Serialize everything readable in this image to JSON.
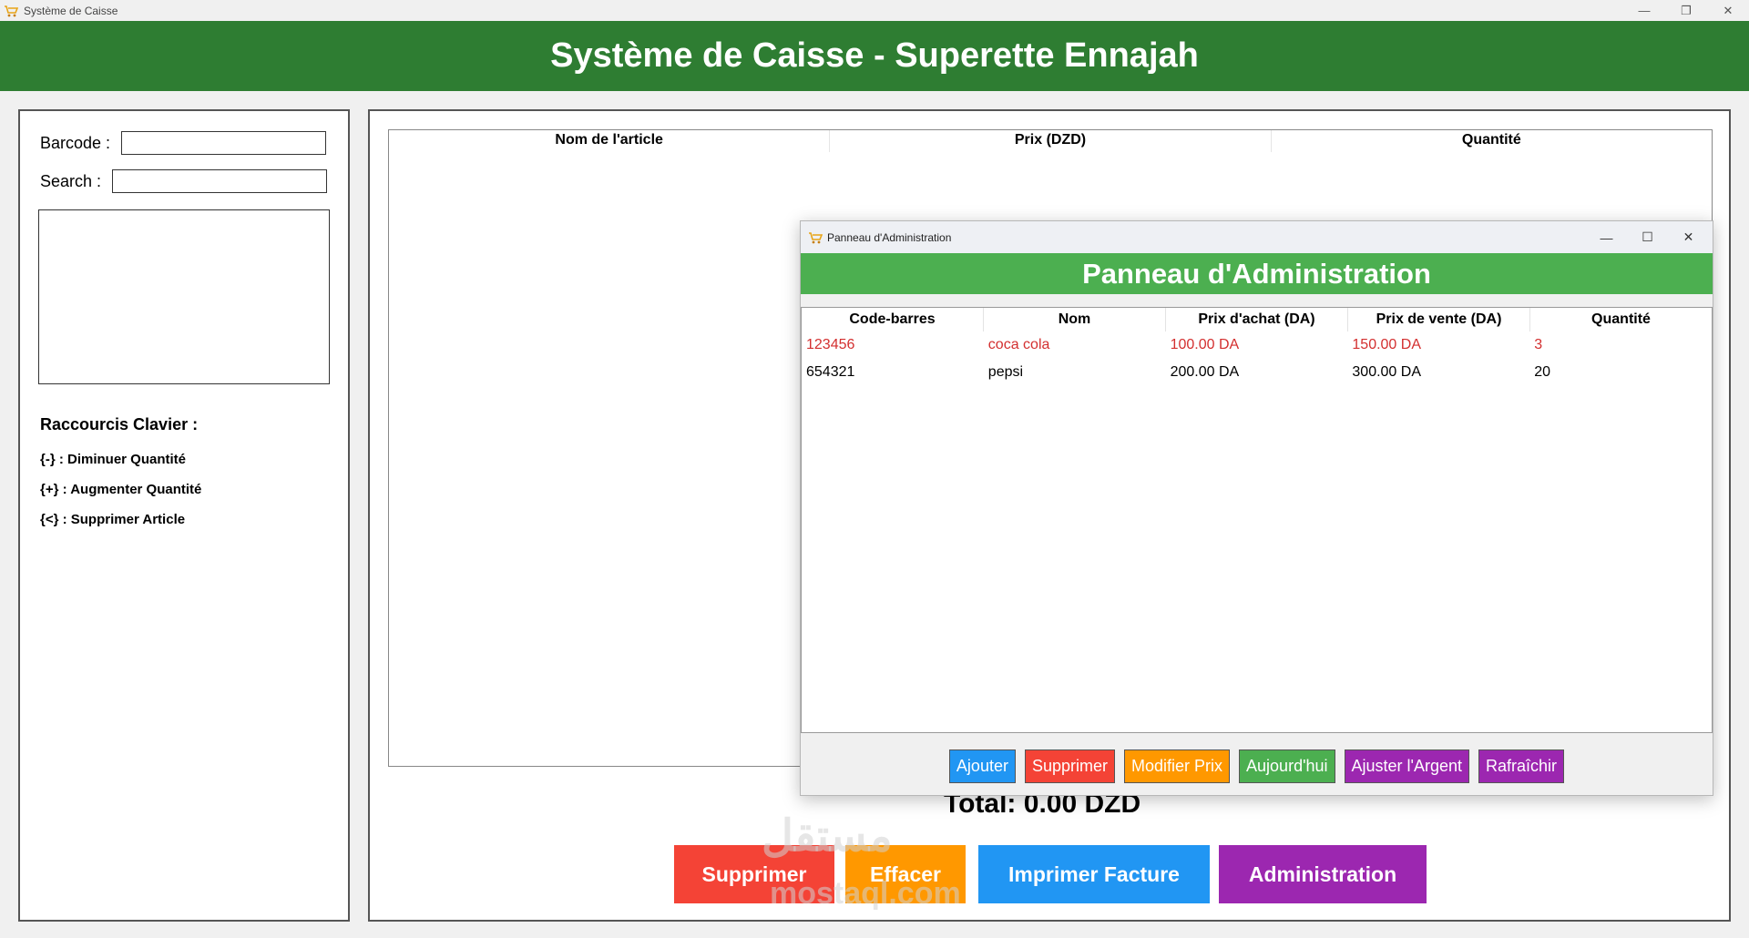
{
  "window": {
    "title": "Système de Caisse",
    "icon": "cart-icon"
  },
  "header": {
    "title": "Système de Caisse - Superette Ennajah"
  },
  "left": {
    "barcode_label": "Barcode :",
    "barcode_value": "",
    "search_label": "Search :",
    "search_value": "",
    "shortcuts_title": "Raccourcis Clavier :",
    "shortcuts": [
      "{-} : Diminuer Quantité",
      "{+} : Augmenter Quantité",
      "{<} : Supprimer Article"
    ]
  },
  "cart": {
    "columns": [
      "Nom de l'article",
      "Prix (DZD)",
      "Quantité"
    ],
    "rows": []
  },
  "total": "Total: 0.00 DZD",
  "actions": {
    "supprimer": "Supprimer",
    "effacer": "Effacer",
    "imprimer": "Imprimer Facture",
    "administration": "Administration"
  },
  "admin": {
    "window_title": "Panneau d'Administration",
    "header": "Panneau d'Administration",
    "columns": [
      "Code-barres",
      "Nom",
      "Prix d'achat (DA)",
      "Prix de vente (DA)",
      "Quantité"
    ],
    "rows": [
      {
        "barcode": "123456",
        "name": "coca cola",
        "buy": "100.00 DA",
        "sell": "150.00 DA",
        "qty": "3",
        "low_stock": true
      },
      {
        "barcode": "654321",
        "name": "pepsi",
        "buy": "200.00 DA",
        "sell": "300.00 DA",
        "qty": "20",
        "low_stock": false
      }
    ],
    "buttons": {
      "ajouter": "Ajouter",
      "supprimer": "Supprimer",
      "modifier": "Modifier Prix",
      "aujourdhui": "Aujourd'hui",
      "ajuster": "Ajuster l'Argent",
      "rafraichir": "Rafraîchir"
    }
  },
  "watermark": {
    "brand": "مستقل",
    "domain": "mostaql.com"
  },
  "colors": {
    "header_green": "#2e7d32",
    "admin_green": "#4caf50",
    "red": "#f44336",
    "orange": "#ff9800",
    "blue": "#2196f3",
    "purple": "#9c27b0",
    "admin_blue": "#2196f3",
    "admin_red": "#f44336",
    "admin_orange": "#ff9800",
    "admin_green_btn": "#4caf50",
    "admin_purple": "#9c27b0",
    "low_stock_text": "#d32f2f"
  }
}
